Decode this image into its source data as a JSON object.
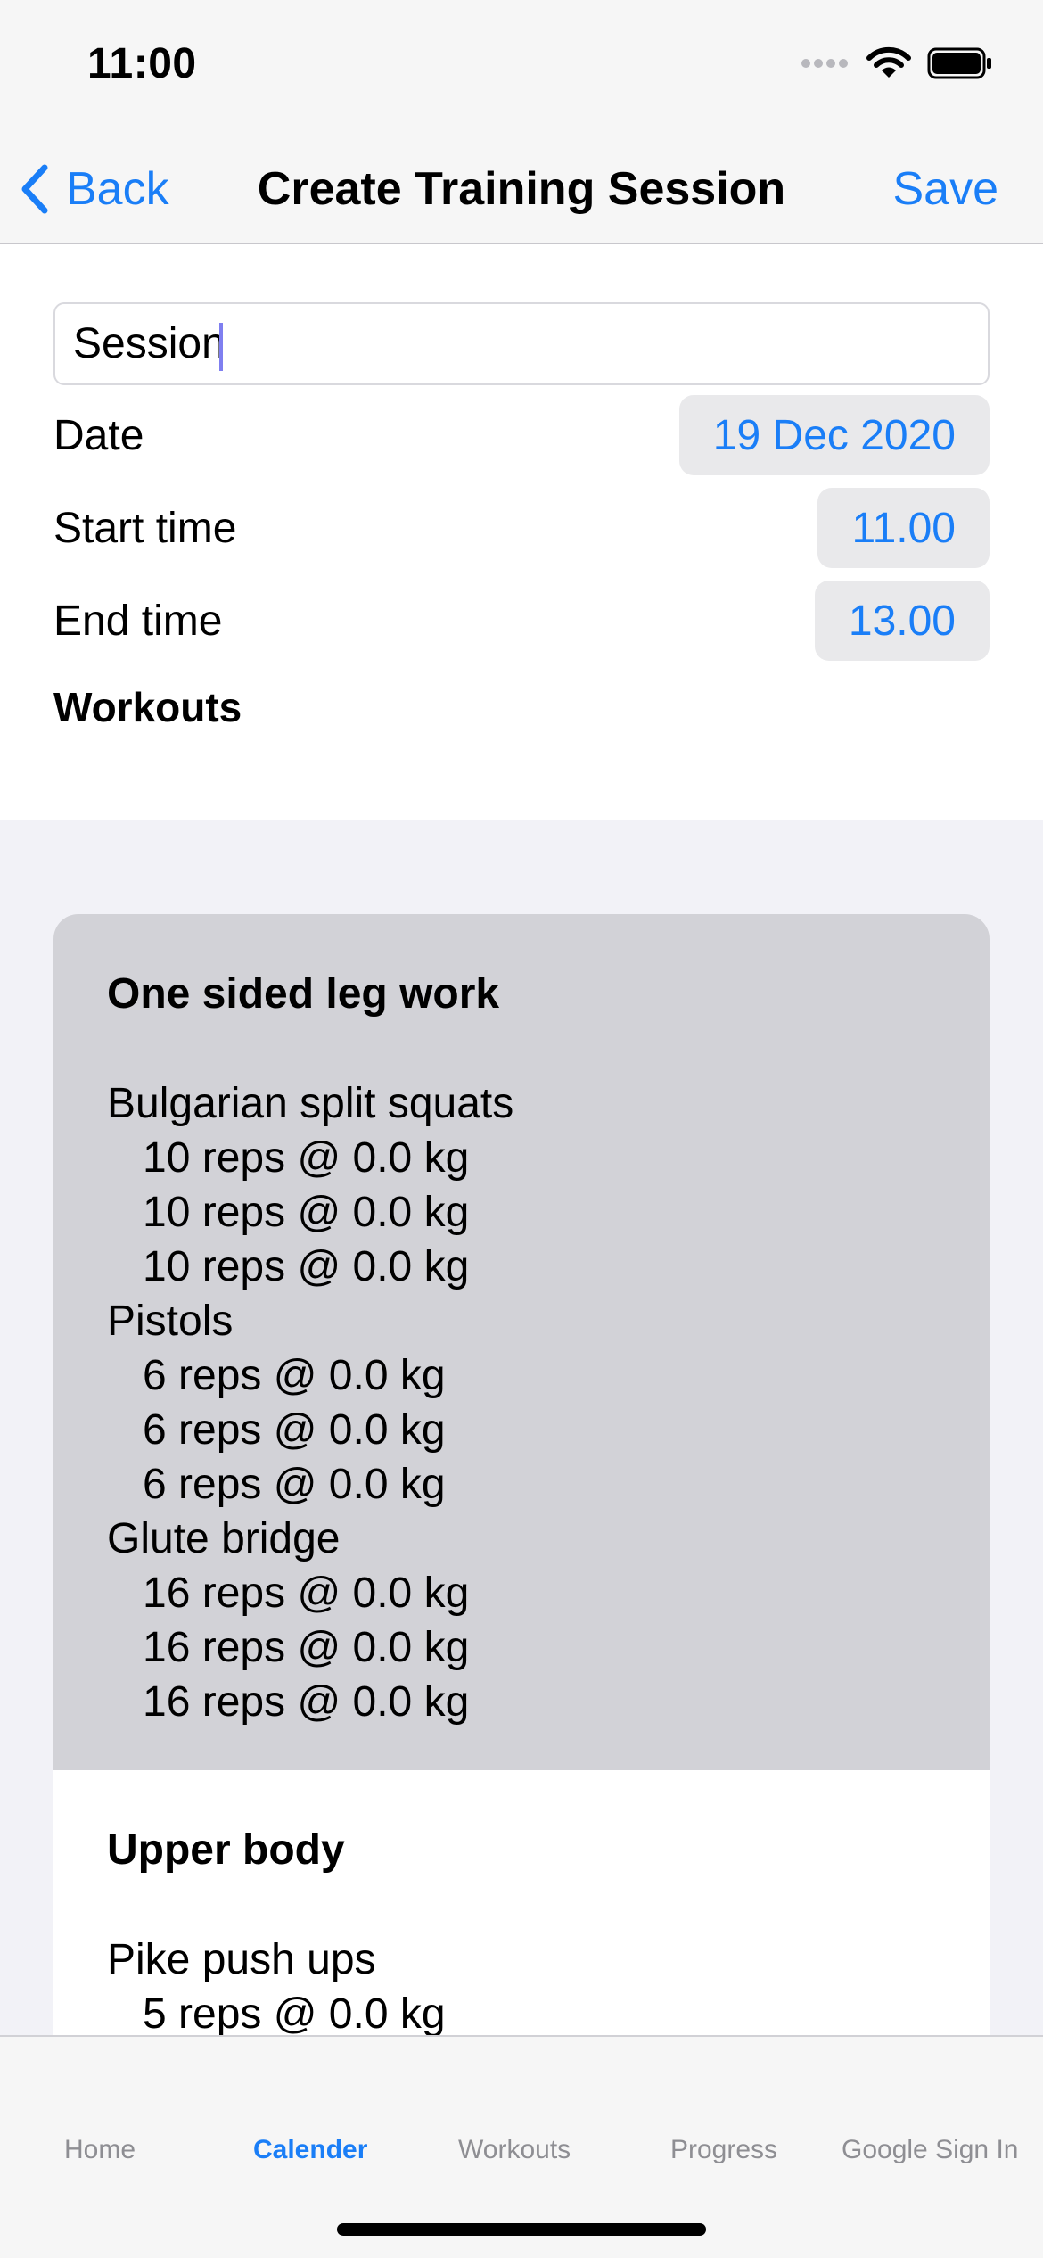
{
  "status_bar": {
    "time": "11:00"
  },
  "nav": {
    "back_label": "Back",
    "title": "Create Training Session",
    "save_label": "Save"
  },
  "form": {
    "session_name": "Session",
    "date_label": "Date",
    "date_value": "19 Dec 2020",
    "start_label": "Start time",
    "start_value": "11.00",
    "end_label": "End time",
    "end_value": "13.00",
    "workouts_heading": "Workouts"
  },
  "workouts": [
    {
      "title": "One sided leg work",
      "selected": true,
      "exercises": [
        {
          "name": "Bulgarian split squats",
          "sets": [
            "10 reps @ 0.0 kg",
            "10 reps @ 0.0 kg",
            "10 reps @ 0.0 kg"
          ]
        },
        {
          "name": "Pistols",
          "sets": [
            "6 reps @ 0.0 kg",
            "6 reps @ 0.0 kg",
            "6 reps @ 0.0 kg"
          ]
        },
        {
          "name": "Glute bridge",
          "sets": [
            "16 reps @ 0.0 kg",
            "16 reps @ 0.0 kg",
            "16 reps @ 0.0 kg"
          ]
        }
      ]
    },
    {
      "title": "Upper body",
      "selected": false,
      "exercises": [
        {
          "name": "Pike push ups",
          "sets": [
            "5 reps @ 0.0 kg"
          ]
        }
      ]
    }
  ],
  "tabs": [
    {
      "label": "Home",
      "active": false
    },
    {
      "label": "Calender",
      "active": true
    },
    {
      "label": "Workouts",
      "active": false
    },
    {
      "label": "Progress",
      "active": false
    },
    {
      "label": "Google Sign In",
      "active": false
    }
  ],
  "colors": {
    "accent": "#1a7ef7",
    "selected_card": "#d2d2d7",
    "pill_bg": "#e9e9eb"
  },
  "icons": [
    "chevron-left-icon",
    "signal-icon",
    "wifi-icon",
    "battery-icon"
  ]
}
